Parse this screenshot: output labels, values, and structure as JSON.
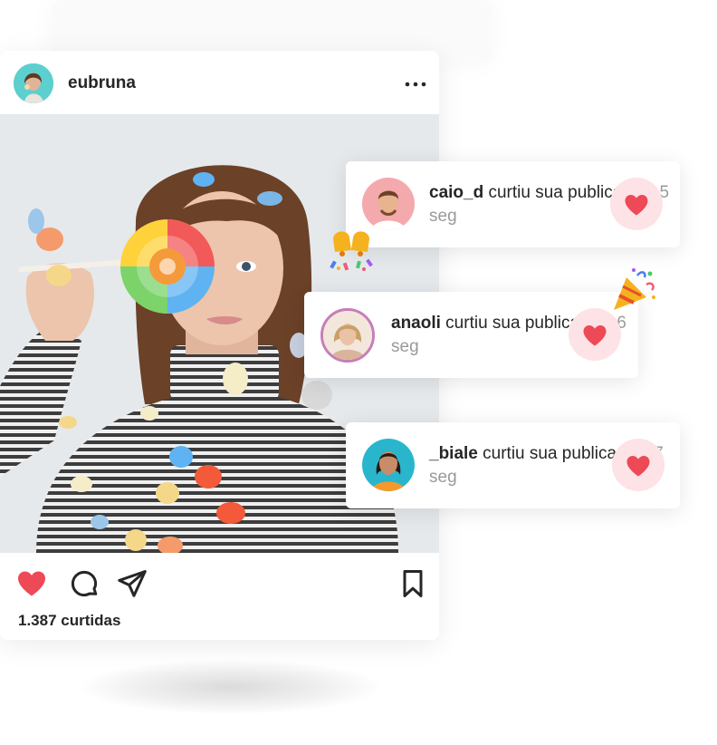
{
  "post": {
    "username": "eubruna",
    "more_icon": "more-horizontal-icon",
    "likes_count": "1.387 curtidas",
    "liked": true,
    "accent_color": "#ed4956"
  },
  "notifications": [
    {
      "user": "caio_d",
      "message": " curtiu sua publicação. ",
      "time": "5 seg",
      "avatar_bg": "#f3b5b8"
    },
    {
      "user": "anaoli",
      "message": " curtiu sua publicação. ",
      "time": "6 seg",
      "avatar_bg": "#e8d8c6"
    },
    {
      "user": "_biale",
      "message": " curtiu sua publicação. ",
      "time": "7 seg",
      "avatar_bg": "#27b8cf"
    }
  ],
  "colors": {
    "heart": "#ed4956",
    "heart_bubble": "#fde2e6",
    "time_text": "#9a9a9a"
  }
}
